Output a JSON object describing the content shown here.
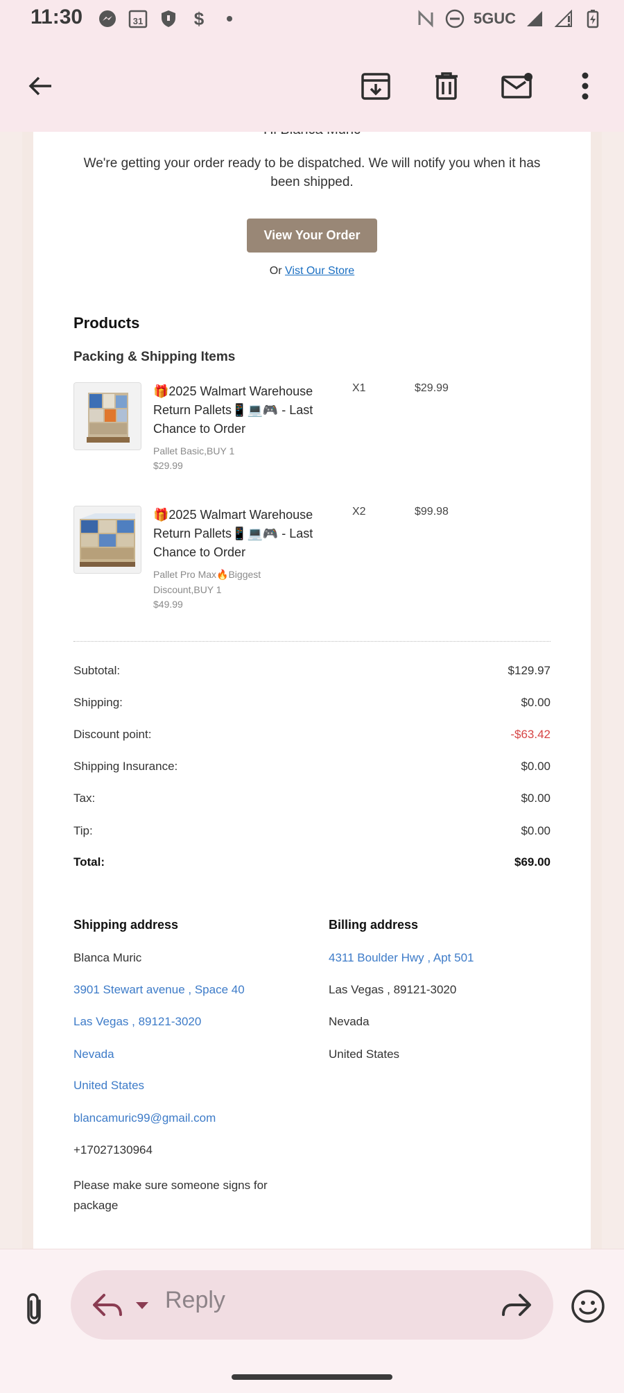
{
  "status_bar": {
    "time": "11:30",
    "calendar_day": "31",
    "network": "5GUC",
    "icons_left": [
      "messenger-icon",
      "calendar-icon",
      "shield-icon",
      "dollar-icon",
      "dot-icon"
    ],
    "icons_right": [
      "nfc-icon",
      "do-not-disturb-icon",
      "signal-icon",
      "signal-alt-icon",
      "battery-charging-icon"
    ]
  },
  "toolbar": {
    "icons": [
      "back-arrow-icon",
      "archive-icon",
      "delete-icon",
      "mark-unread-icon",
      "more-vert-icon"
    ]
  },
  "email": {
    "greeting": "Hi Blanca Muric",
    "intro": "We're getting your order ready to be dispatched. We will notify you when it has been shipped.",
    "view_order_button": "View Your Order",
    "store_prefix": "Or",
    "store_link": "Vist Our Store",
    "products_heading": "Products",
    "packing_heading": "Packing & Shipping Items",
    "items": [
      {
        "title": "🎁2025 Walmart Warehouse Return Pallets📱💻🎮 - Last Chance to Order",
        "variant": "Pallet Basic,BUY 1",
        "unit_price": "$29.99",
        "qty": "X1",
        "line_total": "$29.99"
      },
      {
        "title": "🎁2025 Walmart Warehouse Return Pallets📱💻🎮 - Last Chance to Order",
        "variant": "Pallet Pro Max🔥Biggest Discount,BUY 1",
        "unit_price": "$49.99",
        "qty": "X2",
        "line_total": "$99.98"
      }
    ],
    "summary": [
      {
        "label": "Subtotal:",
        "value": "$129.97"
      },
      {
        "label": "Shipping:",
        "value": "$0.00"
      },
      {
        "label": "Discount point:",
        "value": "-$63.42"
      },
      {
        "label": "Shipping Insurance:",
        "value": "$0.00"
      },
      {
        "label": "Tax:",
        "value": "$0.00"
      },
      {
        "label": "Tip:",
        "value": "$0.00"
      },
      {
        "label": "Total:",
        "value": "$69.00"
      }
    ],
    "shipping_address": {
      "heading": "Shipping address",
      "name": "Blanca Muric",
      "street": "3901 Stewart avenue , Space 40",
      "city": "Las Vegas , 89121-3020",
      "state": "Nevada",
      "country": "United States",
      "email": "blancamuric99@gmail.com",
      "phone": "+17027130964",
      "note": "Please make sure someone signs for package"
    },
    "billing_address": {
      "heading": "Billing address",
      "street": "4311 Boulder Hwy , Apt 501",
      "city": "Las Vegas , 89121-3020",
      "state": "Nevada",
      "country": "United States"
    }
  },
  "reply_bar": {
    "placeholder": "Reply"
  },
  "colors": {
    "header_bg": "#f9e8ec",
    "button_bg": "#998776",
    "link": "#3d7bc8",
    "discount": "#d64545"
  }
}
